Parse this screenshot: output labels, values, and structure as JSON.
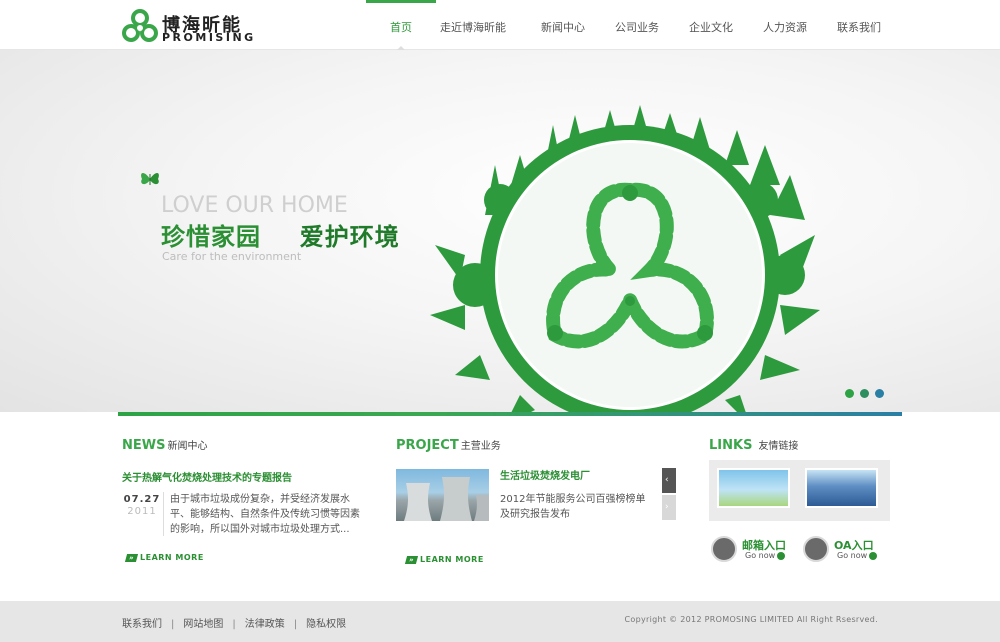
{
  "brand": {
    "name_cn": "博海昕能",
    "name_en": "PROMISING",
    "color": "#2f9a3b"
  },
  "nav": {
    "items": [
      "首页",
      "走近博海昕能",
      "新闻中心",
      "公司业务",
      "企业文化",
      "人力资源",
      "联系我们"
    ],
    "active": "首页"
  },
  "banner": {
    "heading_en": "LOVE OUR HOME",
    "heading_cn_1": "珍惜家园",
    "heading_cn_2": "爱护环境",
    "subtext": "Care for the environment",
    "slide_count": 3
  },
  "news": {
    "title_en": "NEWS",
    "title_cn": "新闻中心",
    "headline": "关于热解气化焚烧处理技术的专题报告",
    "date_md": "07.27",
    "date_year": "2011",
    "body": "由于城市垃圾成份复杂，并受经济发展水平、能够结构、自然条件及传统习惯等因素的影响，所以国外对城市垃圾处理方式...",
    "learn_more": "LEARN MORE"
  },
  "project": {
    "title_en": "PROJECT",
    "title_cn": "主营业务",
    "headline": "生活垃圾焚烧发电厂",
    "body": "2012年节能服务公司百强榜榜单及研究报告发布",
    "learn_more": "LEARN MORE"
  },
  "links": {
    "title_en": "LINKS",
    "title_cn": "友情链接",
    "mail_label": "邮箱入口",
    "oa_label": "OA入口",
    "go_now": "Go now"
  },
  "footer": {
    "links": [
      "联系我们",
      "网站地图",
      "法律政策",
      "隐私权限"
    ],
    "copyright": "Copyright © 2012  PROMOSING LIMITED All Right Rsesrved."
  }
}
